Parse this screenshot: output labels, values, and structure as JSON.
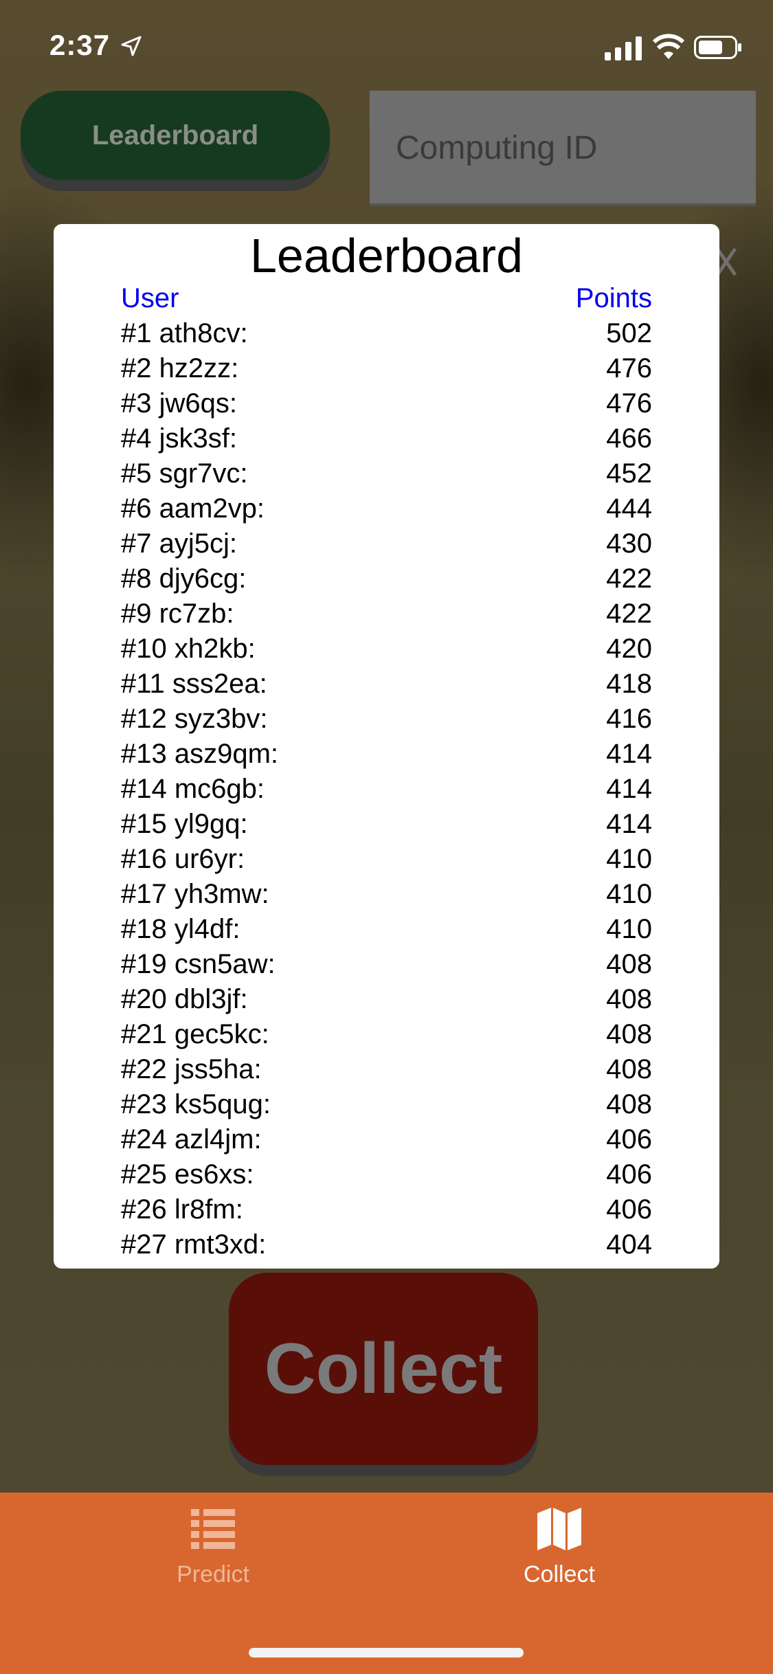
{
  "status": {
    "time": "2:37"
  },
  "top": {
    "leaderboard_button": "Leaderboard",
    "computing_id_placeholder": "Computing ID"
  },
  "modal": {
    "title": "Leaderboard",
    "col_user": "User",
    "col_points": "Points",
    "rows": [
      {
        "user": "#1 ath8cv:",
        "points": "502"
      },
      {
        "user": "#2 hz2zz:",
        "points": "476"
      },
      {
        "user": "#3 jw6qs:",
        "points": "476"
      },
      {
        "user": "#4 jsk3sf:",
        "points": "466"
      },
      {
        "user": "#5 sgr7vc:",
        "points": "452"
      },
      {
        "user": "#6 aam2vp:",
        "points": "444"
      },
      {
        "user": "#7 ayj5cj:",
        "points": "430"
      },
      {
        "user": "#8 djy6cg:",
        "points": "422"
      },
      {
        "user": "#9 rc7zb:",
        "points": "422"
      },
      {
        "user": "#10 xh2kb:",
        "points": "420"
      },
      {
        "user": "#11 sss2ea:",
        "points": "418"
      },
      {
        "user": "#12 syz3bv:",
        "points": "416"
      },
      {
        "user": "#13 asz9qm:",
        "points": "414"
      },
      {
        "user": "#14 mc6gb:",
        "points": "414"
      },
      {
        "user": "#15 yl9gq:",
        "points": "414"
      },
      {
        "user": "#16 ur6yr:",
        "points": "410"
      },
      {
        "user": "#17 yh3mw:",
        "points": "410"
      },
      {
        "user": "#18 yl4df:",
        "points": "410"
      },
      {
        "user": "#19 csn5aw:",
        "points": "408"
      },
      {
        "user": "#20 dbl3jf:",
        "points": "408"
      },
      {
        "user": "#21 gec5kc:",
        "points": "408"
      },
      {
        "user": "#22 jss5ha:",
        "points": "408"
      },
      {
        "user": "#23 ks5qug:",
        "points": "408"
      },
      {
        "user": "#24 azl4jm:",
        "points": "406"
      },
      {
        "user": "#25 es6xs:",
        "points": "406"
      },
      {
        "user": "#26 lr8fm:",
        "points": "406"
      },
      {
        "user": "#27 rmt3xd:",
        "points": "404"
      }
    ]
  },
  "main": {
    "collect_button": "Collect"
  },
  "tabs": [
    {
      "label": "Predict",
      "icon": "list-icon",
      "active": false
    },
    {
      "label": "Collect",
      "icon": "map-icon",
      "active": true
    }
  ],
  "colors": {
    "tab_bar": "#d8672f",
    "leaderboard_button": "#163a1f",
    "collect_button": "#5a0e08",
    "header_link": "#0000ee"
  }
}
